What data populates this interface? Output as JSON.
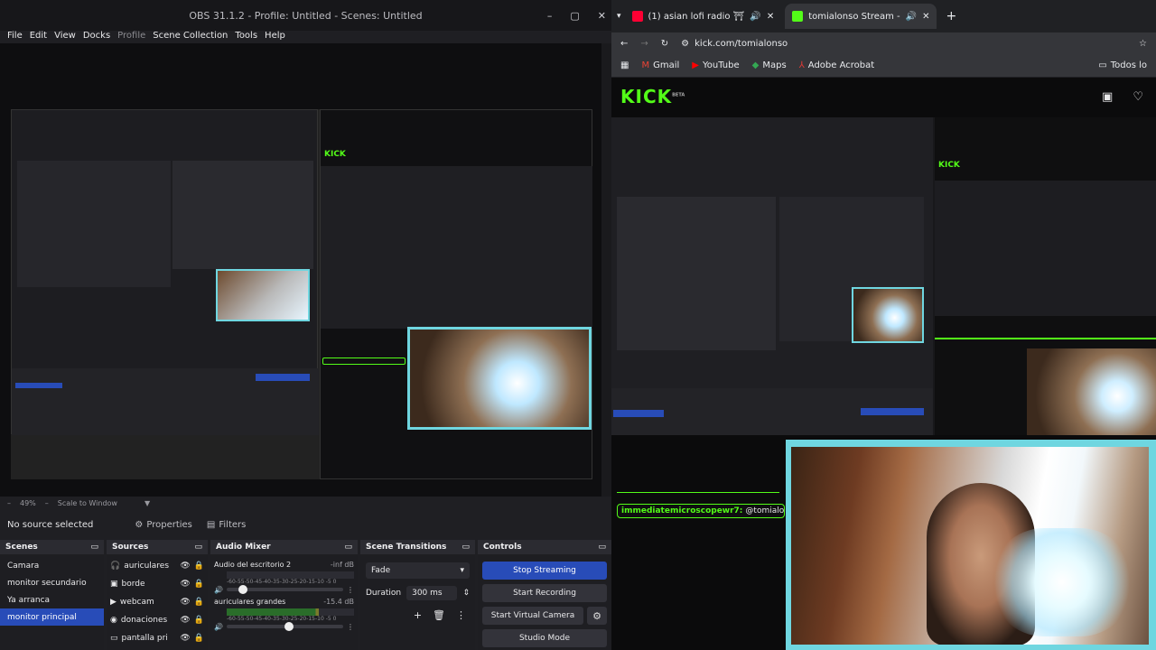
{
  "obs": {
    "title": "OBS 31.1.2 - Profile: Untitled - Scenes: Untitled",
    "menu": [
      "File",
      "Edit",
      "View",
      "Docks",
      "Profile",
      "Scene Collection",
      "Tools",
      "Help"
    ],
    "zoom": "49%",
    "scale_mode": "Scale to Window",
    "no_source": "No source selected",
    "properties_label": "Properties",
    "filters_label": "Filters",
    "scenes": {
      "title": "Scenes",
      "items": [
        "Camara",
        "monitor secundario",
        "Ya arranca",
        "monitor principal"
      ],
      "selected_index": 3
    },
    "sources": {
      "title": "Sources",
      "items": [
        "auriculares",
        "borde",
        "webcam",
        "donaciones",
        "pantalla pri"
      ]
    },
    "mixer": {
      "title": "Audio Mixer",
      "channels": [
        {
          "name": "Audio del escritorio 2",
          "db": "-inf dB",
          "level": 0,
          "volume": 0.1
        },
        {
          "name": "auriculares grandes",
          "db": "-15.4 dB",
          "level": 0.72,
          "volume": 0.5
        }
      ],
      "ticks": "-60-55-50-45-40-35-30-25-20-15-10 -5 0"
    },
    "transitions": {
      "title": "Scene Transitions",
      "selected": "Fade",
      "duration_label": "Duration",
      "duration": "300 ms"
    },
    "controls": {
      "title": "Controls",
      "stop_streaming": "Stop Streaming",
      "start_recording": "Start Recording",
      "start_virtual_camera": "Start Virtual Camera",
      "studio_mode": "Studio Mode"
    }
  },
  "browser": {
    "tabs": [
      {
        "title": "(1) asian lofi radio ⛩",
        "fav_color": "#ff0033"
      },
      {
        "title": "tomialonso Stream - ",
        "fav_color": "#53fc18"
      }
    ],
    "url": "kick.com/tomialonso",
    "bookmarks": [
      {
        "label": "Gmail",
        "icon": "gmail-icon"
      },
      {
        "label": "YouTube",
        "icon": "youtube-icon"
      },
      {
        "label": "Maps",
        "icon": "maps-icon"
      },
      {
        "label": "Adobe Acrobat",
        "icon": "acrobat-icon"
      }
    ],
    "all_bookmarks": "Todos lo",
    "kick_logo": "KICK",
    "kick_beta": "BETA",
    "chat": {
      "user": "immediatemicroscopewr7:",
      "message": "@tomialonso Tire"
    }
  },
  "colors": {
    "accent_blue": "#284cb8",
    "kick_green": "#53fc18",
    "cam_border": "#6fd6e0"
  }
}
